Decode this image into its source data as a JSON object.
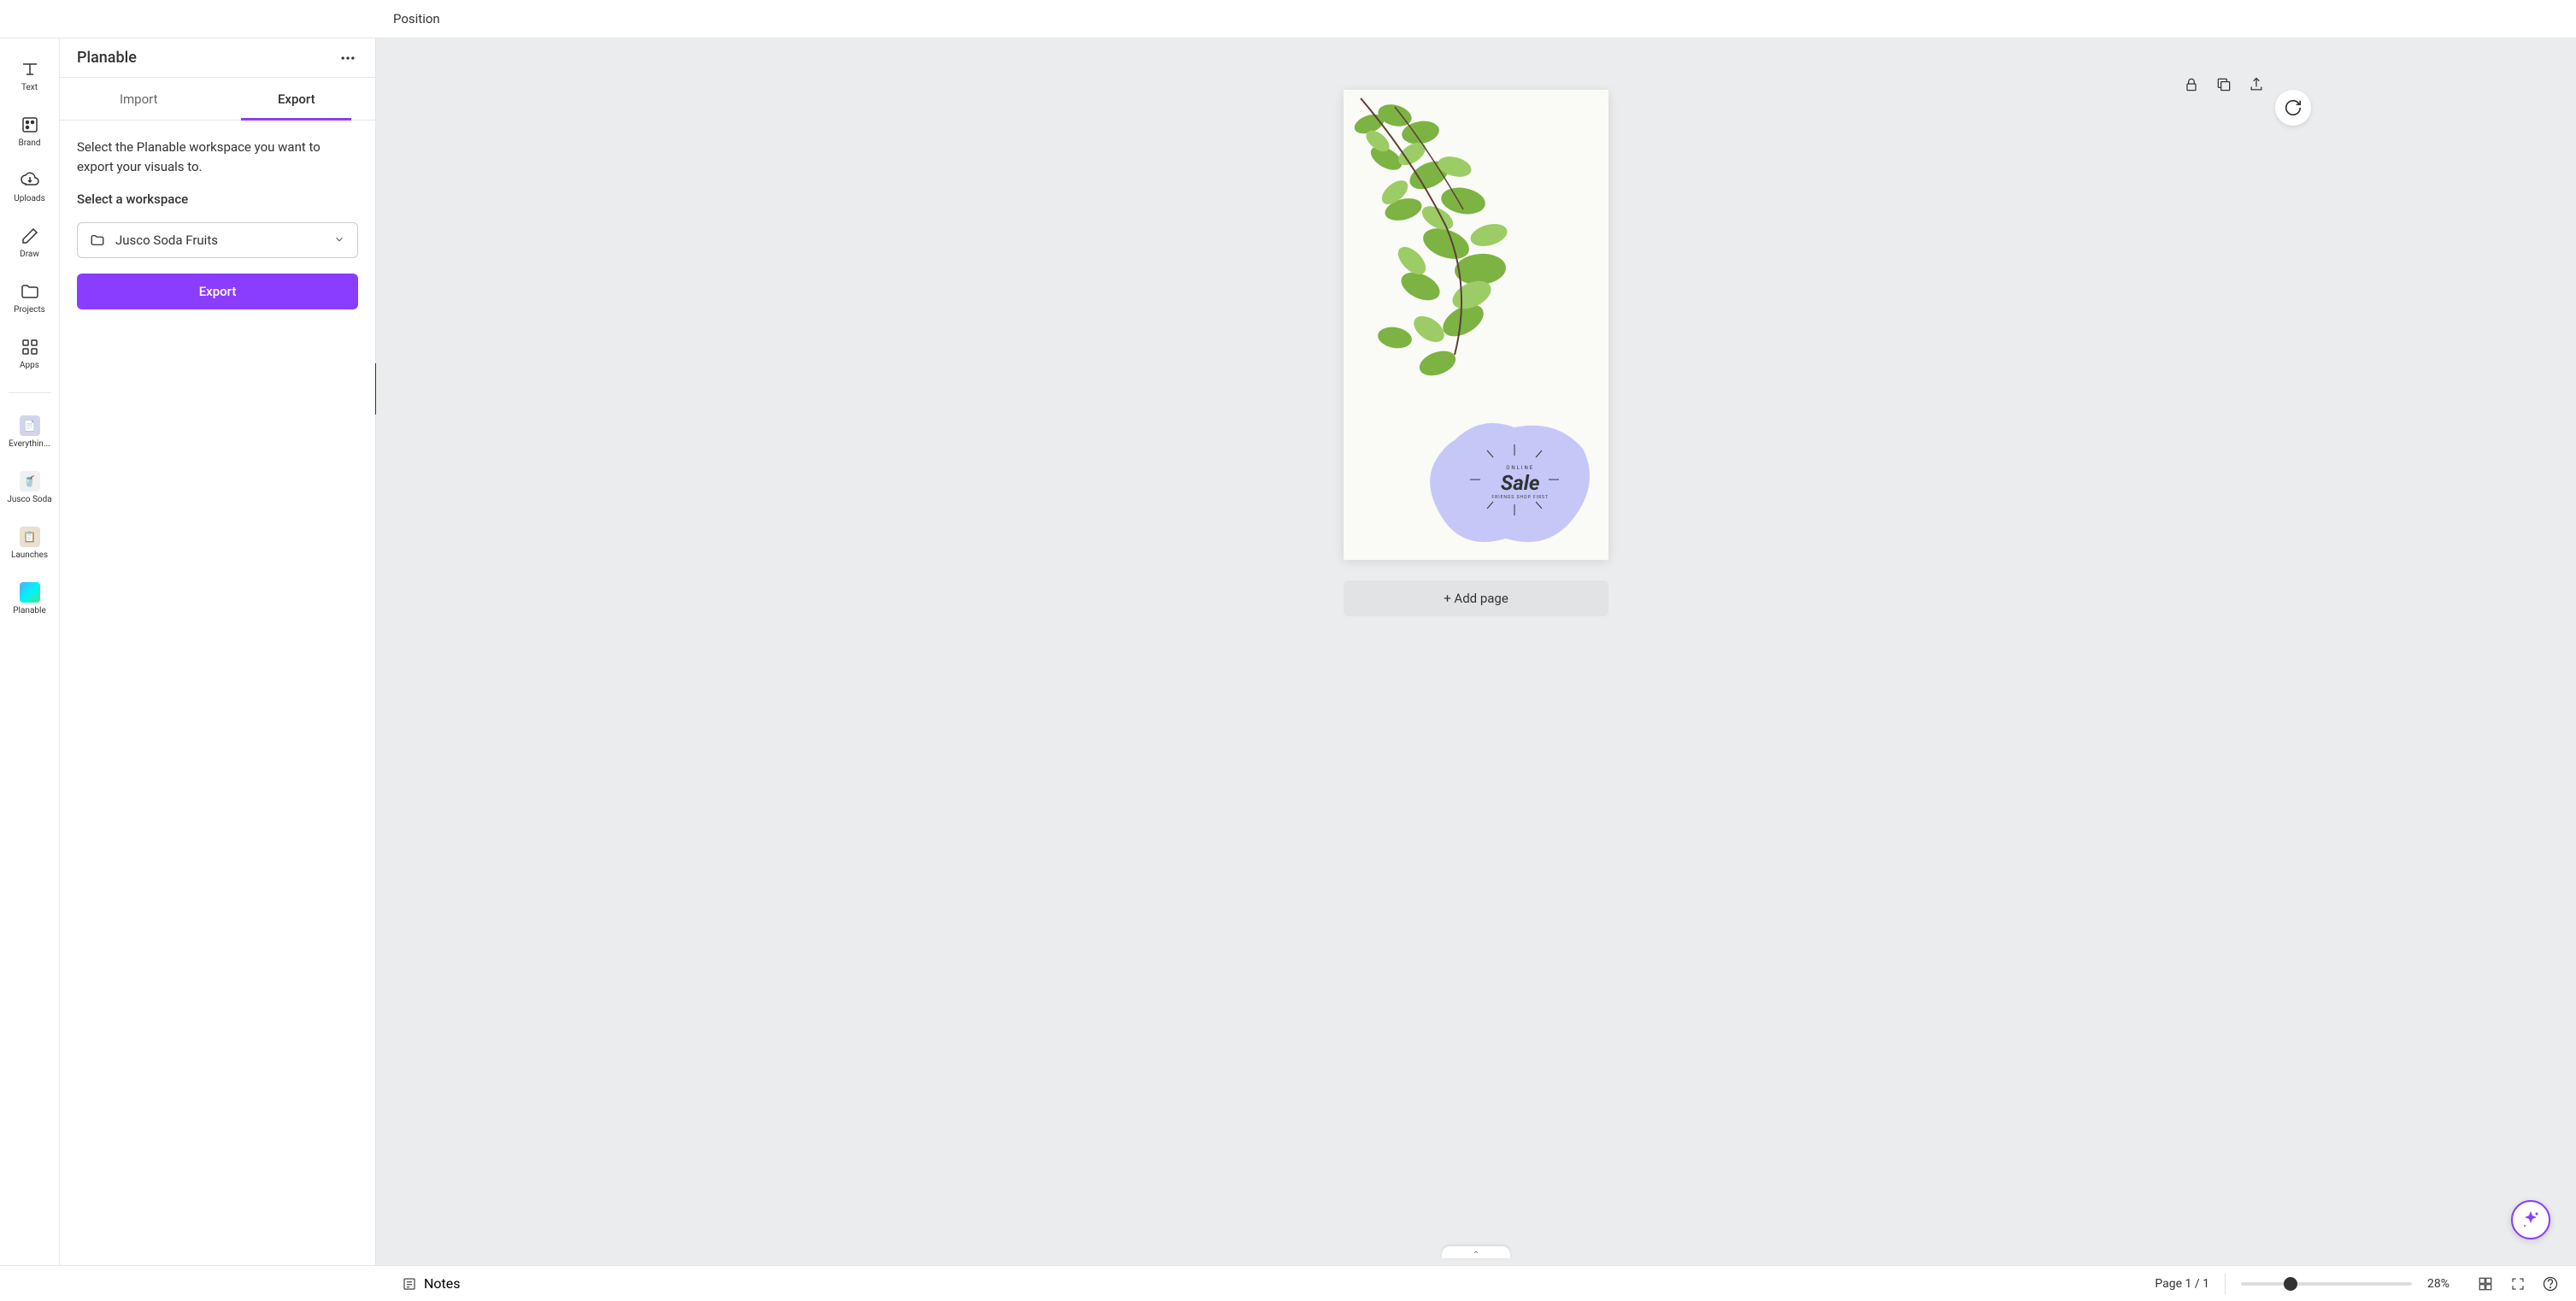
{
  "topbar": {
    "position_label": "Position"
  },
  "rail": {
    "items": [
      {
        "label": "Text",
        "icon": "T"
      },
      {
        "label": "Brand",
        "icon": "brand"
      },
      {
        "label": "Uploads",
        "icon": "cloud"
      },
      {
        "label": "Draw",
        "icon": "pencil"
      },
      {
        "label": "Projects",
        "icon": "folder"
      },
      {
        "label": "Apps",
        "icon": "grid"
      }
    ],
    "thumbs": [
      {
        "label": "Everythin..."
      },
      {
        "label": "Jusco Soda"
      },
      {
        "label": "Launches"
      },
      {
        "label": "Planable"
      }
    ]
  },
  "panel": {
    "title": "Planable",
    "tabs": {
      "import": "Import",
      "export": "Export",
      "active": "export"
    },
    "description": "Select the Planable workspace you want to export your visuals to.",
    "workspace_label": "Select a workspace",
    "workspace_value": "Jusco Soda Fruits",
    "export_btn": "Export"
  },
  "canvas": {
    "sale": {
      "online": "ONLINE",
      "main": "Sale",
      "sub": "FRIENDS SHOP FIRST"
    },
    "add_page": "+ Add page"
  },
  "bottombar": {
    "notes": "Notes",
    "page_indicator": "Page 1 / 1",
    "zoom": "28%"
  }
}
